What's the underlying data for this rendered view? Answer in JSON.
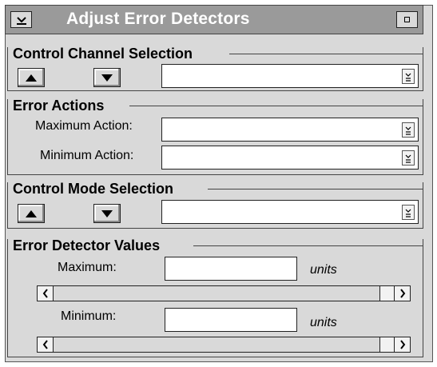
{
  "window": {
    "title": "Adjust Error Detectors"
  },
  "icons": {
    "window_menu": "chevron-down-icon",
    "minimize": "minimize-icon",
    "up": "up-arrow-icon",
    "down": "down-arrow-icon",
    "dropdown": "chevron-down-icon",
    "scroll_left": "left-arrow-icon",
    "scroll_right": "right-arrow-icon"
  },
  "control_channel": {
    "title": "Control Channel Selection",
    "selected": ""
  },
  "error_actions": {
    "title": "Error Actions",
    "max_label": "Maximum Action:",
    "max_value": "",
    "min_label": "Minimum Action:",
    "min_value": ""
  },
  "control_mode": {
    "title": "Control Mode Selection",
    "selected": ""
  },
  "values": {
    "title": "Error Detector Values",
    "max_label": "Maximum:",
    "max_value": "",
    "max_unit": "units",
    "min_label": "Minimum:",
    "min_value": "",
    "min_unit": "units"
  },
  "colors": {
    "window_bg": "#d9d9d9",
    "titlebar": "#9a9a9a",
    "title_text": "#ffffff"
  }
}
